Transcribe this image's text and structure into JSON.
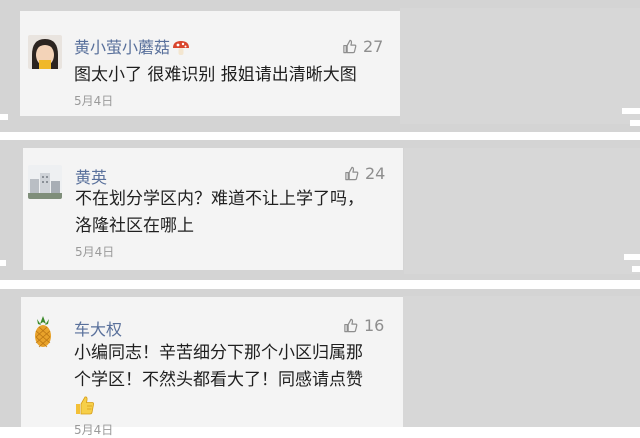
{
  "comments": [
    {
      "name": "黄小萤小蘑菇",
      "text_lines": [
        "图太小了 很难识别 报姐请出清晰大图"
      ],
      "date": "5月4日",
      "likes": "27",
      "avatar_icon": "girl-face-avatar-icon",
      "name_icon": "mushroom-icon"
    },
    {
      "name": "黄英",
      "text_lines": [
        "不在划分学区内？难道不让上学了吗，",
        "洛隆社区在哪上"
      ],
      "date": "5月4日",
      "likes": "24",
      "avatar_icon": "building-avatar-icon"
    },
    {
      "name": "车大权",
      "text_lines": [
        "小编同志！辛苦细分下那个小区归属那",
        "个学区！不然头都看大了！同感请点赞"
      ],
      "date": "5月4日",
      "likes": "16",
      "avatar_icon": "pineapple-avatar-icon",
      "emoji_icon": "thumbs-up-emoji-icon"
    }
  ],
  "colors": {
    "name": "#59709b",
    "card": "#f4f4f4",
    "strip": "#d4d4d4",
    "likes": "#8e8e8e",
    "date": "#9a9a9a"
  }
}
